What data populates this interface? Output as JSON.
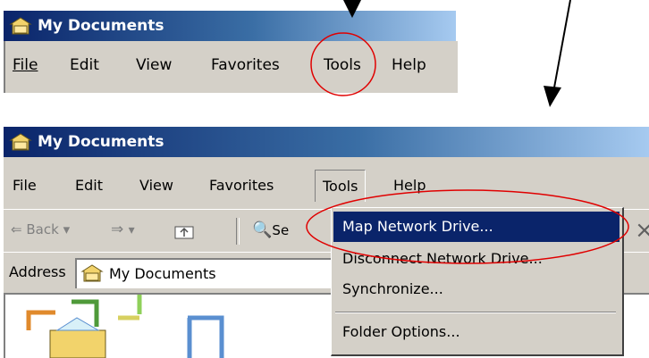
{
  "window_title": "My Documents",
  "menu": {
    "file": "File",
    "edit": "Edit",
    "view": "View",
    "favorites": "Favorites",
    "tools": "Tools",
    "help": "Help"
  },
  "toolbar": {
    "back": "Back",
    "search_partial": "Se"
  },
  "address": {
    "label": "Address",
    "value": "My Documents"
  },
  "tools_menu": {
    "items": [
      "Map Network Drive...",
      "Disconnect Network Drive...",
      "Synchronize...",
      "Folder Options..."
    ],
    "highlighted_index": 0
  },
  "colors": {
    "title_start": "#0a246a",
    "title_end": "#a6caf0",
    "chrome": "#d4d0c8",
    "highlight": "#0a246a",
    "annotation": "#e00000"
  },
  "icons": [
    "folder-icon",
    "back-arrow-icon",
    "forward-arrow-icon",
    "up-folder-icon",
    "search-icon"
  ]
}
